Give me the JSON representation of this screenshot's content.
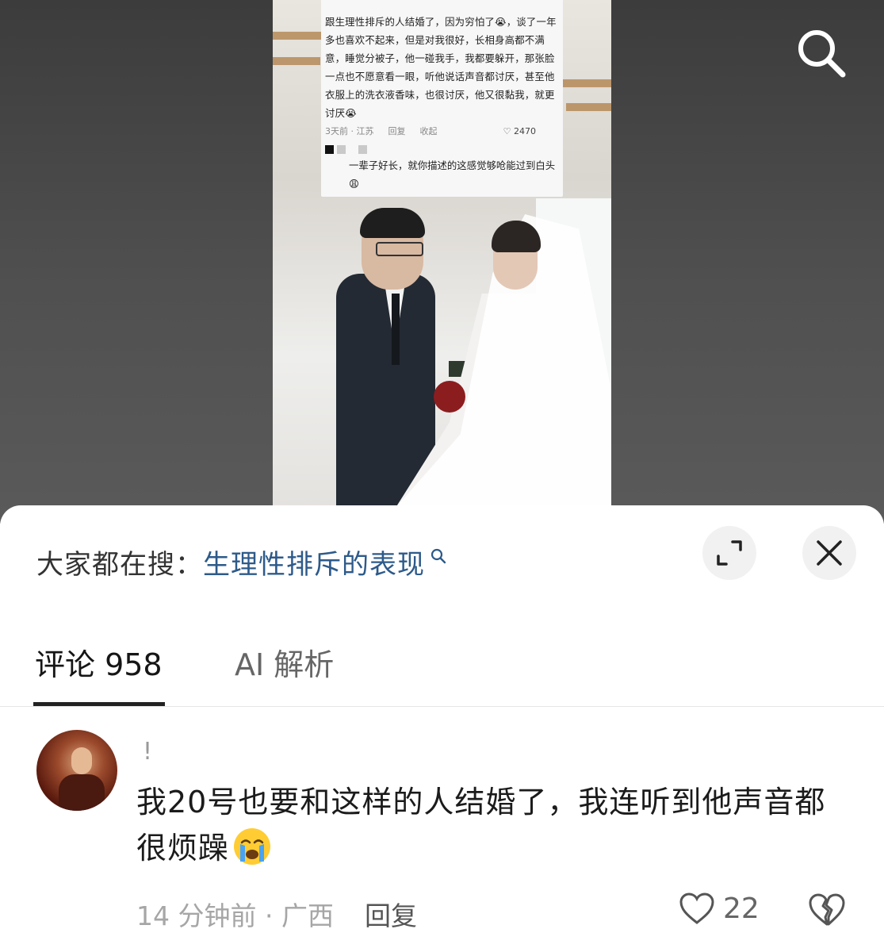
{
  "video": {
    "card_comment_text": "跟生理性排斥的人结婚了，因为穷怕了😭，谈了一年多也喜欢不起来，但是对我很好，长相身高都不满意，睡觉分被子，他一碰我手，我都要躲开，那张脸一点也不愿意看一眼，听他说话声音都讨厌，甚至他衣服上的洗衣液香味，也很讨厌，他又很黏我，就更讨厌😭",
    "card_collapse": "收起",
    "card_time_location": "3天前 · 江苏",
    "card_reply": "回复",
    "card_likes": "2470",
    "card_reply_text": "一辈子好长，就你描述的这感觉够呛能过到白头😩"
  },
  "panel": {
    "hot_search_prefix": "大家都在搜：",
    "hot_search_query": "生理性排斥的表现",
    "tabs": [
      {
        "label": "评论 958",
        "active": true
      },
      {
        "label": "AI 解析",
        "active": false
      }
    ]
  },
  "comment": {
    "username": "!",
    "text": "我20号也要和这样的人结婚了，我连听到他声音都很烦躁",
    "emoji": "crying-face",
    "time_location": "14 分钟前 · 广西",
    "reply_label": "回复",
    "likes": "22"
  },
  "colors": {
    "link": "#2d5a8a",
    "panel_bg": "#ffffff",
    "video_bg": "#4a4a4a"
  }
}
